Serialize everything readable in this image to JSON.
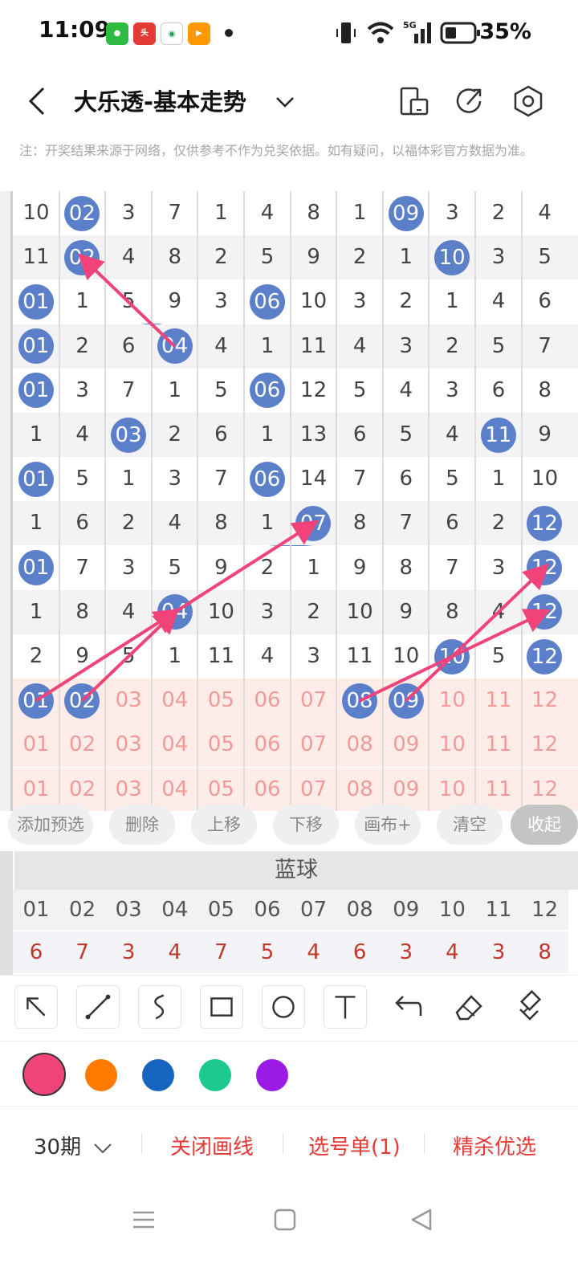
{
  "status_bar": {
    "time": "11:09",
    "battery": "35%",
    "app_icons": [
      "wechat-icon",
      "toutiao-icon",
      "china-mobile-icon",
      "video-app-icon"
    ]
  },
  "header": {
    "title": "大乐透-基本走势"
  },
  "notice": "注：开奖结果来源于网络，仅供参考不作为兑奖依据。如有疑问，以福体彩官方数据为准。",
  "grid": {
    "rows": [
      [
        "10",
        "02",
        "3",
        "7",
        "1",
        "4",
        "8",
        "1",
        "09",
        "3",
        "2",
        "4"
      ],
      [
        "11",
        "02",
        "4",
        "8",
        "2",
        "5",
        "9",
        "2",
        "1",
        "10",
        "3",
        "5"
      ],
      [
        "01",
        "1",
        "5",
        "9",
        "3",
        "06",
        "10",
        "3",
        "2",
        "1",
        "4",
        "6"
      ],
      [
        "01",
        "2",
        "6",
        "04",
        "4",
        "1",
        "11",
        "4",
        "3",
        "2",
        "5",
        "7"
      ],
      [
        "01",
        "3",
        "7",
        "1",
        "5",
        "06",
        "12",
        "5",
        "4",
        "3",
        "6",
        "8"
      ],
      [
        "1",
        "4",
        "03",
        "2",
        "6",
        "1",
        "13",
        "6",
        "5",
        "4",
        "11",
        "9"
      ],
      [
        "01",
        "5",
        "1",
        "3",
        "7",
        "06",
        "14",
        "7",
        "6",
        "5",
        "1",
        "10"
      ],
      [
        "1",
        "6",
        "2",
        "4",
        "8",
        "1",
        "07",
        "8",
        "7",
        "6",
        "2",
        "12"
      ],
      [
        "01",
        "7",
        "3",
        "5",
        "9",
        "2",
        "1",
        "9",
        "8",
        "7",
        "3",
        "12"
      ],
      [
        "1",
        "8",
        "4",
        "04",
        "10",
        "3",
        "2",
        "10",
        "9",
        "8",
        "4",
        "12"
      ],
      [
        "2",
        "9",
        "5",
        "1",
        "11",
        "4",
        "3",
        "11",
        "10",
        "10",
        "5",
        "12"
      ]
    ],
    "hit_cells": [
      [
        0,
        1
      ],
      [
        0,
        8
      ],
      [
        1,
        1
      ],
      [
        1,
        9
      ],
      [
        2,
        0
      ],
      [
        2,
        5
      ],
      [
        3,
        0
      ],
      [
        3,
        3
      ],
      [
        4,
        0
      ],
      [
        4,
        5
      ],
      [
        5,
        2
      ],
      [
        5,
        10
      ],
      [
        6,
        0
      ],
      [
        6,
        5
      ],
      [
        7,
        6
      ],
      [
        7,
        11
      ],
      [
        8,
        0
      ],
      [
        8,
        11
      ],
      [
        9,
        3
      ],
      [
        9,
        11
      ],
      [
        10,
        9
      ],
      [
        10,
        11
      ]
    ],
    "pick_rows": [
      [
        "01",
        "02",
        "03",
        "04",
        "05",
        "06",
        "07",
        "08",
        "09",
        "10",
        "11",
        "12"
      ],
      [
        "01",
        "02",
        "03",
        "04",
        "05",
        "06",
        "07",
        "08",
        "09",
        "10",
        "11",
        "12"
      ],
      [
        "01",
        "02",
        "03",
        "04",
        "05",
        "06",
        "07",
        "08",
        "09",
        "10",
        "11",
        "12"
      ]
    ],
    "selected_picks": [
      0,
      1,
      7,
      8
    ]
  },
  "actions": {
    "add": "添加预选",
    "delete": "删除",
    "up": "上移",
    "down": "下移",
    "canvas": "画布+",
    "clear": "清空",
    "collapse": "收起"
  },
  "blue_summary": {
    "title": "蓝球",
    "numbers": [
      "01",
      "02",
      "03",
      "04",
      "05",
      "06",
      "07",
      "08",
      "09",
      "10",
      "11",
      "12"
    ],
    "counts": [
      "6",
      "7",
      "3",
      "4",
      "7",
      "5",
      "4",
      "6",
      "3",
      "4",
      "3",
      "8"
    ]
  },
  "tools": [
    "arrow-tool-icon",
    "line-tool-icon",
    "curve-tool-icon",
    "rectangle-tool-icon",
    "circle-tool-icon",
    "text-tool-icon",
    "undo-icon",
    "eraser-icon",
    "brush-clear-icon"
  ],
  "palette": [
    "#f0437a",
    "#ff7a00",
    "#1565c0",
    "#1dc98d",
    "#9c1ae6"
  ],
  "bottom_bar": {
    "period": "30期",
    "close_lines": "关闭画线",
    "ticket": "选号单(1)",
    "kill": "精杀优选"
  }
}
